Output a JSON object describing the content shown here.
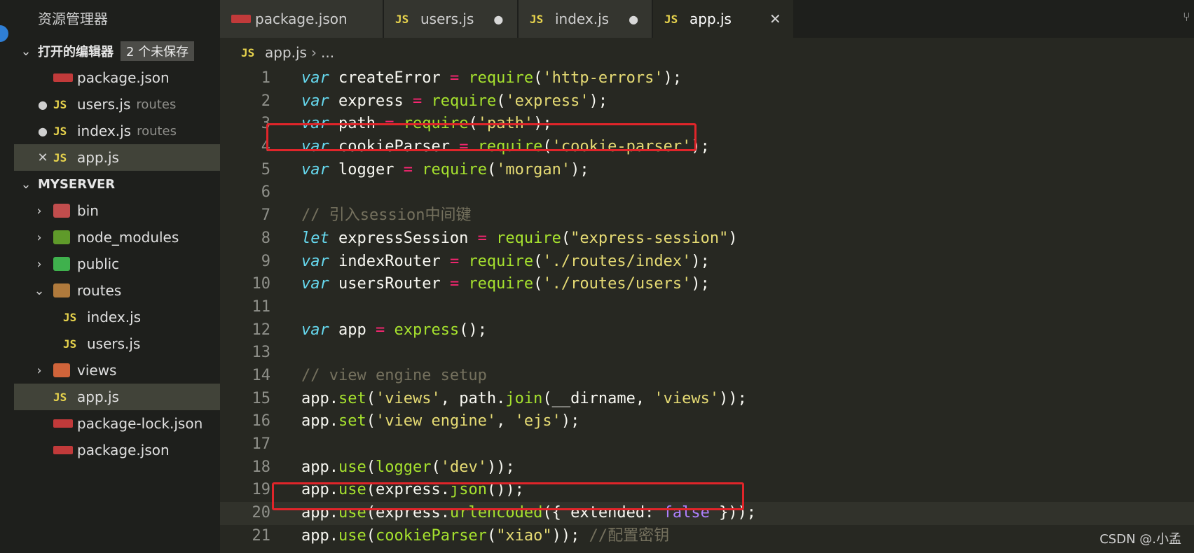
{
  "sidebar": {
    "title": "资源管理器",
    "open_editors": {
      "header": "打开的编辑器",
      "badge": "2 个未保存",
      "items": [
        {
          "label": "package.json",
          "desc": "",
          "mark": ""
        },
        {
          "label": "users.js",
          "desc": "routes",
          "mark": "●"
        },
        {
          "label": "index.js",
          "desc": "routes",
          "mark": "●"
        },
        {
          "label": "app.js",
          "desc": "",
          "mark": "✕"
        }
      ]
    },
    "project": {
      "header": "MYSERVER",
      "items": [
        {
          "label": "bin"
        },
        {
          "label": "node_modules"
        },
        {
          "label": "public"
        },
        {
          "label": "routes"
        },
        {
          "label": "index.js"
        },
        {
          "label": "users.js"
        },
        {
          "label": "views"
        },
        {
          "label": "app.js"
        },
        {
          "label": "package-lock.json"
        },
        {
          "label": "package.json"
        }
      ]
    }
  },
  "tabs": [
    {
      "label": "package.json",
      "status": ""
    },
    {
      "label": "users.js",
      "status": "●"
    },
    {
      "label": "index.js",
      "status": "●"
    },
    {
      "label": "app.js",
      "status": "✕"
    }
  ],
  "icons": {
    "js": "JS"
  },
  "breadcrumb": {
    "file": "app.js",
    "rest": "..."
  },
  "code_lines": [
    {
      "n": "1",
      "tokens": [
        [
          "kw",
          "var"
        ],
        [
          "plain",
          " createError "
        ],
        [
          "op",
          "="
        ],
        [
          "plain",
          " "
        ],
        [
          "fn",
          "require"
        ],
        [
          "plain",
          "("
        ],
        [
          "str",
          "'http-errors'"
        ],
        [
          "plain",
          ");"
        ]
      ]
    },
    {
      "n": "2",
      "tokens": [
        [
          "kw",
          "var"
        ],
        [
          "plain",
          " express "
        ],
        [
          "op",
          "="
        ],
        [
          "plain",
          " "
        ],
        [
          "fn",
          "require"
        ],
        [
          "plain",
          "("
        ],
        [
          "str",
          "'express'"
        ],
        [
          "plain",
          ");"
        ]
      ]
    },
    {
      "n": "3",
      "tokens": [
        [
          "kw",
          "var"
        ],
        [
          "plain",
          " path "
        ],
        [
          "op",
          "="
        ],
        [
          "plain",
          " "
        ],
        [
          "fn",
          "require"
        ],
        [
          "plain",
          "("
        ],
        [
          "str",
          "'path'"
        ],
        [
          "plain",
          ");"
        ]
      ]
    },
    {
      "n": "4",
      "tokens": [
        [
          "kw",
          "var"
        ],
        [
          "plain",
          " cookieParser "
        ],
        [
          "op",
          "="
        ],
        [
          "plain",
          " "
        ],
        [
          "fn",
          "require"
        ],
        [
          "plain",
          "("
        ],
        [
          "str",
          "'cookie-parser'"
        ],
        [
          "plain",
          ");"
        ]
      ]
    },
    {
      "n": "5",
      "tokens": [
        [
          "kw",
          "var"
        ],
        [
          "plain",
          " logger "
        ],
        [
          "op",
          "="
        ],
        [
          "plain",
          " "
        ],
        [
          "fn",
          "require"
        ],
        [
          "plain",
          "("
        ],
        [
          "str",
          "'morgan'"
        ],
        [
          "plain",
          ");"
        ]
      ]
    },
    {
      "n": "6",
      "tokens": []
    },
    {
      "n": "7",
      "tokens": [
        [
          "cm",
          "// 引入session中间键"
        ]
      ]
    },
    {
      "n": "8",
      "tokens": [
        [
          "kw",
          "let"
        ],
        [
          "plain",
          " expressSession "
        ],
        [
          "op",
          "="
        ],
        [
          "plain",
          " "
        ],
        [
          "fn",
          "require"
        ],
        [
          "plain",
          "("
        ],
        [
          "str",
          "\"express-session\""
        ],
        [
          "plain",
          ")"
        ]
      ]
    },
    {
      "n": "9",
      "tokens": [
        [
          "kw",
          "var"
        ],
        [
          "plain",
          " indexRouter "
        ],
        [
          "op",
          "="
        ],
        [
          "plain",
          " "
        ],
        [
          "fn",
          "require"
        ],
        [
          "plain",
          "("
        ],
        [
          "str",
          "'./routes/index'"
        ],
        [
          "plain",
          ");"
        ]
      ]
    },
    {
      "n": "10",
      "tokens": [
        [
          "kw",
          "var"
        ],
        [
          "plain",
          " usersRouter "
        ],
        [
          "op",
          "="
        ],
        [
          "plain",
          " "
        ],
        [
          "fn",
          "require"
        ],
        [
          "plain",
          "("
        ],
        [
          "str",
          "'./routes/users'"
        ],
        [
          "plain",
          ");"
        ]
      ]
    },
    {
      "n": "11",
      "tokens": []
    },
    {
      "n": "12",
      "tokens": [
        [
          "kw",
          "var"
        ],
        [
          "plain",
          " app "
        ],
        [
          "op",
          "="
        ],
        [
          "plain",
          " "
        ],
        [
          "fn",
          "express"
        ],
        [
          "plain",
          "();"
        ]
      ]
    },
    {
      "n": "13",
      "tokens": []
    },
    {
      "n": "14",
      "tokens": [
        [
          "cm",
          "// view engine setup"
        ]
      ]
    },
    {
      "n": "15",
      "tokens": [
        [
          "plain",
          "app."
        ],
        [
          "fn",
          "set"
        ],
        [
          "plain",
          "("
        ],
        [
          "str",
          "'views'"
        ],
        [
          "plain",
          ", path."
        ],
        [
          "fn",
          "join"
        ],
        [
          "plain",
          "(__dirname, "
        ],
        [
          "str",
          "'views'"
        ],
        [
          "plain",
          "));"
        ]
      ]
    },
    {
      "n": "16",
      "tokens": [
        [
          "plain",
          "app."
        ],
        [
          "fn",
          "set"
        ],
        [
          "plain",
          "("
        ],
        [
          "str",
          "'view engine'"
        ],
        [
          "plain",
          ", "
        ],
        [
          "str",
          "'ejs'"
        ],
        [
          "plain",
          ");"
        ]
      ]
    },
    {
      "n": "17",
      "tokens": []
    },
    {
      "n": "18",
      "tokens": [
        [
          "plain",
          "app."
        ],
        [
          "fn",
          "use"
        ],
        [
          "plain",
          "("
        ],
        [
          "fn",
          "logger"
        ],
        [
          "plain",
          "("
        ],
        [
          "str",
          "'dev'"
        ],
        [
          "plain",
          "));"
        ]
      ]
    },
    {
      "n": "19",
      "tokens": [
        [
          "plain",
          "app."
        ],
        [
          "fn",
          "use"
        ],
        [
          "plain",
          "(express."
        ],
        [
          "fn",
          "json"
        ],
        [
          "plain",
          "());"
        ]
      ]
    },
    {
      "n": "20",
      "tokens": [
        [
          "plain",
          "app."
        ],
        [
          "fn",
          "use"
        ],
        [
          "plain",
          "(express."
        ],
        [
          "fn",
          "urlencoded"
        ],
        [
          "plain",
          "({ extended: "
        ],
        [
          "num",
          "false"
        ],
        [
          "plain",
          " }));"
        ]
      ]
    },
    {
      "n": "21",
      "tokens": [
        [
          "plain",
          "app."
        ],
        [
          "fn",
          "use"
        ],
        [
          "plain",
          "("
        ],
        [
          "fn",
          "cookieParser"
        ],
        [
          "plain",
          "("
        ],
        [
          "str",
          "\"xiao\""
        ],
        [
          "plain",
          "));"
        ],
        [
          "plain",
          " "
        ],
        [
          "cm",
          "//配置密钥"
        ]
      ]
    }
  ],
  "watermark": "CSDN @.小孟"
}
